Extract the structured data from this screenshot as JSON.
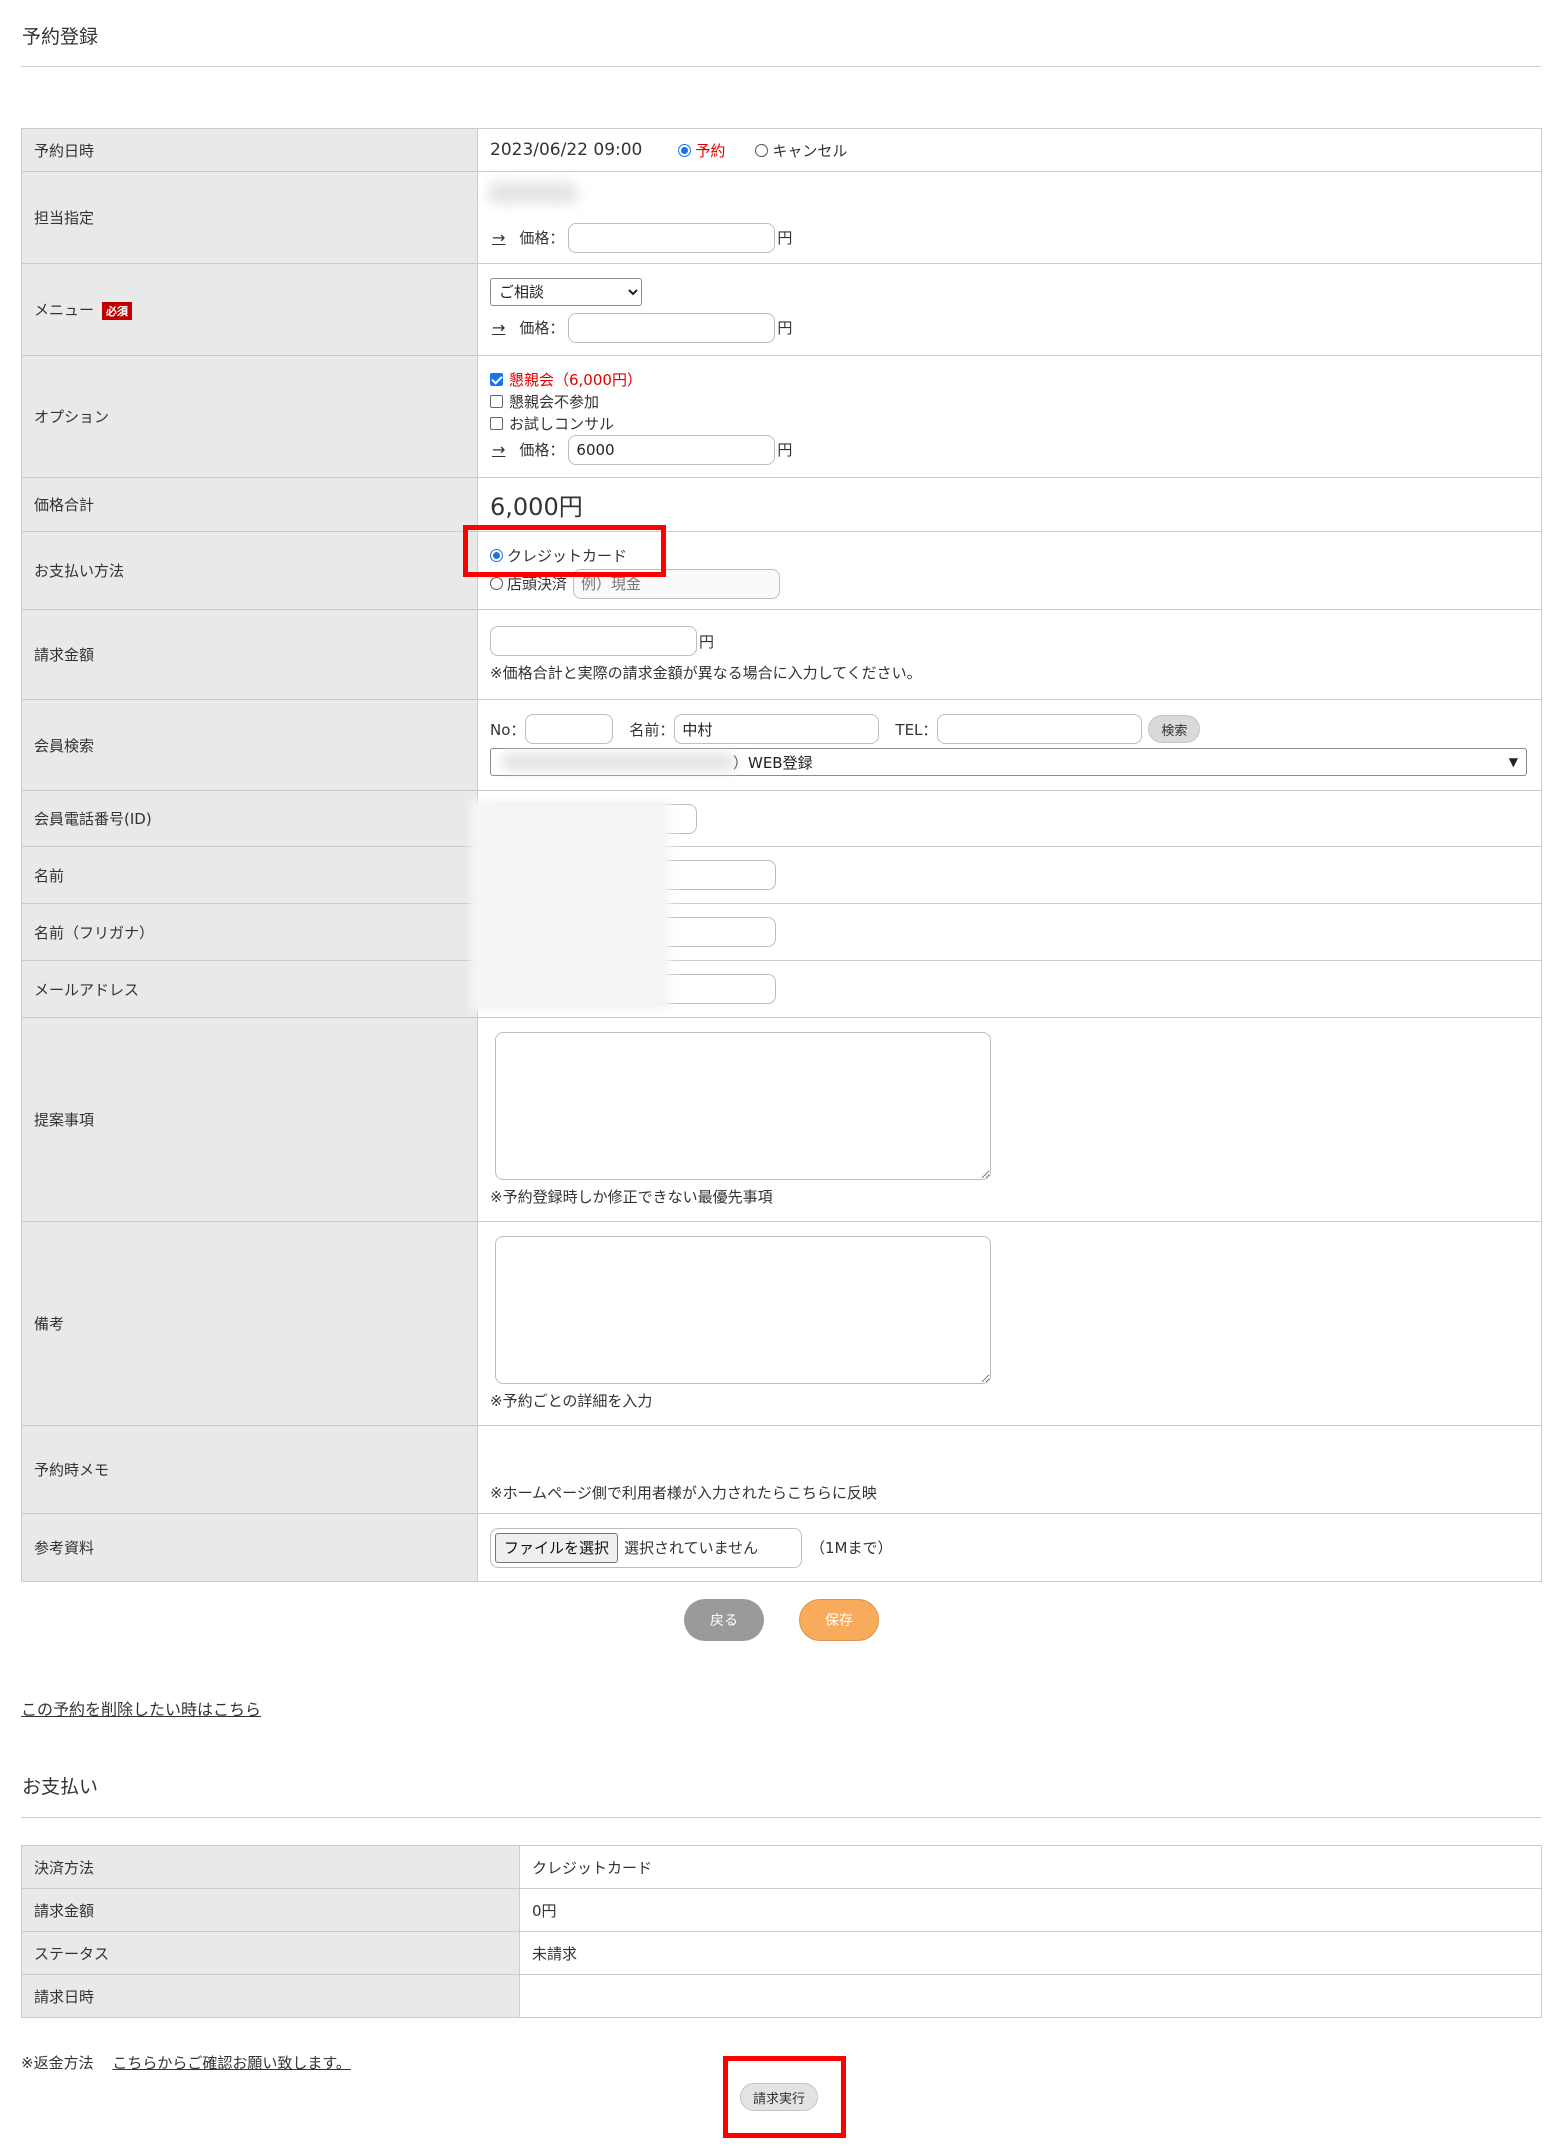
{
  "header": {
    "title": "予約登録"
  },
  "form": {
    "reservation_datetime": {
      "label": "予約日時",
      "value": "2023/06/22 09:00",
      "status_reserve": "予約",
      "status_cancel": "キャンセル"
    },
    "staff": {
      "label": "担当指定",
      "price_label": "価格：",
      "price_value": "",
      "yen": "円"
    },
    "menu": {
      "label": "メニュー",
      "required_badge": "必須",
      "selected": "ご相談",
      "price_label": "価格：",
      "price_value": "",
      "yen": "円"
    },
    "options": {
      "label": "オプション",
      "items": [
        {
          "label": "懇親会（6,000円）",
          "checked": true
        },
        {
          "label": "懇親会不参加",
          "checked": false
        },
        {
          "label": "お試しコンサル",
          "checked": false
        }
      ],
      "price_label": "価格：",
      "price_value": "6000",
      "yen": "円"
    },
    "total": {
      "label": "価格合計",
      "value": "6,000円"
    },
    "payment_method": {
      "label": "お支払い方法",
      "credit_card": "クレジットカード",
      "in_store": "店頭決済",
      "in_store_placeholder": "例）現金"
    },
    "billing_amount": {
      "label": "請求金額",
      "value": "",
      "yen": "円",
      "note": "※価格合計と実際の請求金額が異なる場合に入力してください。"
    },
    "member_search": {
      "label": "会員検索",
      "no_label": "No：",
      "no_value": "",
      "name_label": "名前：",
      "name_value": "中村",
      "tel_label": "TEL：",
      "tel_value": "",
      "search_button": "検索",
      "result_suffix": "）WEB登録"
    },
    "member_phone": {
      "label": "会員電話番号(ID)"
    },
    "name": {
      "label": "名前"
    },
    "name_kana": {
      "label": "名前（フリガナ）"
    },
    "email": {
      "label": "メールアドレス"
    },
    "proposal": {
      "label": "提案事項",
      "note": "※予約登録時しか修正できない最優先事項"
    },
    "remarks": {
      "label": "備考",
      "note": "※予約ごとの詳細を入力"
    },
    "reservation_memo": {
      "label": "予約時メモ",
      "note": "※ホームページ側で利用者様が入力されたらこちらに反映"
    },
    "reference": {
      "label": "参考資料",
      "file_button": "ファイルを選択",
      "file_status": "選択されていません",
      "limit": "（1Mまで）"
    }
  },
  "actions": {
    "back": "戻る",
    "save": "保存"
  },
  "delete_link": "この予約を削除したい時はこちら",
  "payment": {
    "title": "お支払い",
    "rows": [
      {
        "label": "決済方法",
        "value": "クレジットカード"
      },
      {
        "label": "請求金額",
        "value": "0円"
      },
      {
        "label": "ステータス",
        "value": "未請求"
      },
      {
        "label": "請求日時",
        "value": ""
      }
    ],
    "refund_label": "※返金方法",
    "refund_link": "こちらからご確認お願い致します。",
    "request_button": "請求実行"
  },
  "colors": {
    "highlight": "#ff0000",
    "save": "#f8ab5a",
    "back": "#9a9a9a",
    "required": "#c00000",
    "label_bg": "#e9e9e9"
  }
}
